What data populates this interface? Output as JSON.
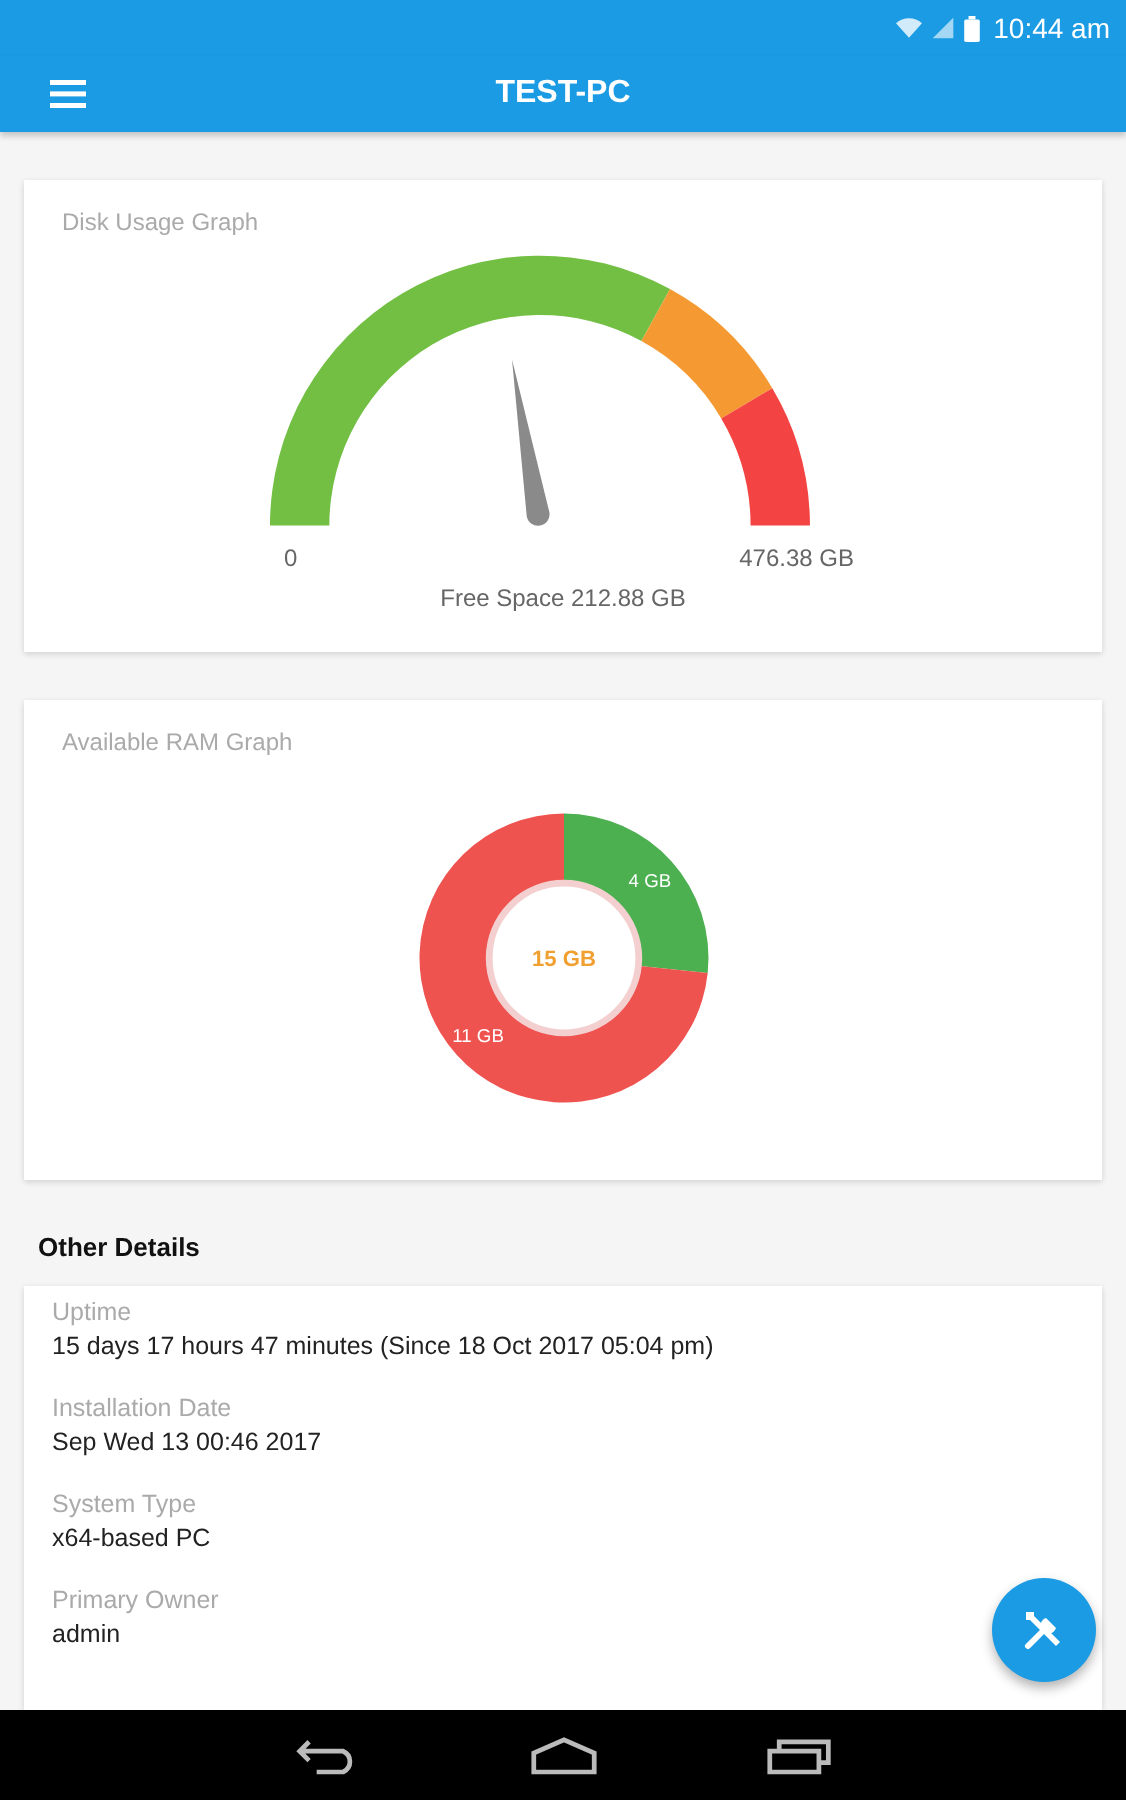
{
  "status_bar": {
    "time": "10:44 am"
  },
  "app_bar": {
    "title": "TEST-PC"
  },
  "disk_card": {
    "title": "Disk Usage Graph",
    "level": 0.447,
    "min_label": "0",
    "max_label": "476.38 GB",
    "reading": "Free Space 212.88 GB"
  },
  "ram_card": {
    "title": "Available RAM Graph",
    "center_label": "15 GB",
    "chart_data": {
      "type": "donut",
      "values": [
        4,
        11
      ],
      "colors": [
        "#4caf50",
        "#ef5350"
      ],
      "value_labels": [
        "4 GB",
        "11 GB"
      ]
    }
  },
  "details": {
    "heading": "Other Details",
    "items": [
      {
        "label": "Uptime",
        "value": "15 days 17 hours 47 minutes  (Since 18 Oct 2017 05:04 pm)"
      },
      {
        "label": "Installation Date",
        "value": "Sep Wed 13 00:46 2017"
      },
      {
        "label": "System Type",
        "value": "x64-based PC"
      },
      {
        "label": "Primary Owner",
        "value": "admin"
      }
    ]
  }
}
